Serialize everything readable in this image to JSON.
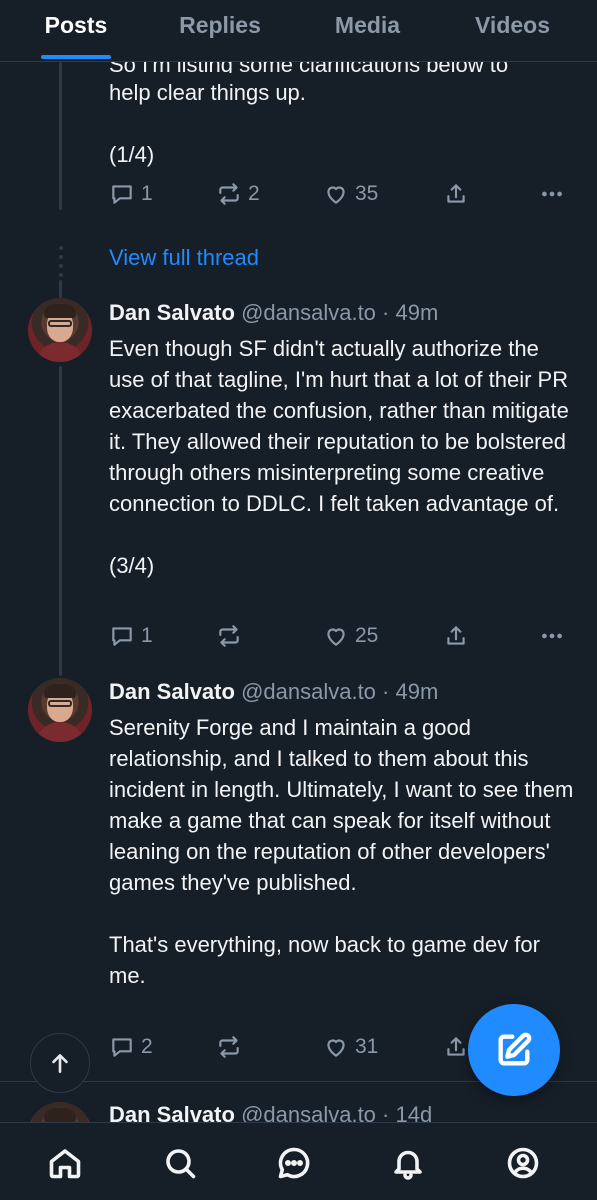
{
  "tabs": [
    {
      "label": "Posts",
      "active": true
    },
    {
      "label": "Replies",
      "active": false
    },
    {
      "label": "Media",
      "active": false
    },
    {
      "label": "Videos",
      "active": false
    }
  ],
  "post1": {
    "text_top": "So I'm listing some clarifications below to",
    "text": "help clear things up.\n\n(1/4)",
    "replies": "1",
    "reposts": "2",
    "likes": "35"
  },
  "thread_link": "View full thread",
  "post2": {
    "name": "Dan Salvato",
    "handle": "@dansalva.to · 49m",
    "text": "Even though SF didn't actually authorize the use of that tagline, I'm hurt that a lot of their PR exacerbated the confusion, rather than mitigate it. They allowed their reputation to be bolstered through others misinterpreting some creative connection to DDLC. I felt taken advantage of.\n\n(3/4)",
    "replies": "1",
    "reposts": "",
    "likes": "25"
  },
  "post3": {
    "name": "Dan Salvato",
    "handle": "@dansalva.to · 49m",
    "text": "Serenity Forge and I maintain a good relationship, and I talked to them about this incident in length. Ultimately, I want to see them make a game that can speak for itself without leaning on the reputation of other developers' games they've published.\n\nThat's everything, now back to game dev for me.",
    "replies": "2",
    "reposts": "",
    "likes": "31"
  },
  "post4": {
    "name": "Dan Salvato",
    "handle": "@dansalva.to · 14d"
  },
  "colors": {
    "background": "#161e27",
    "accent": "#208bfe",
    "muted": "#8a98a8",
    "divider": "#2e3a47"
  },
  "icons": {
    "nav": [
      "home-icon",
      "search-icon",
      "chat-icon",
      "bell-icon",
      "profile-icon"
    ],
    "fab": "compose-icon",
    "scroll": "arrow-up-icon"
  }
}
